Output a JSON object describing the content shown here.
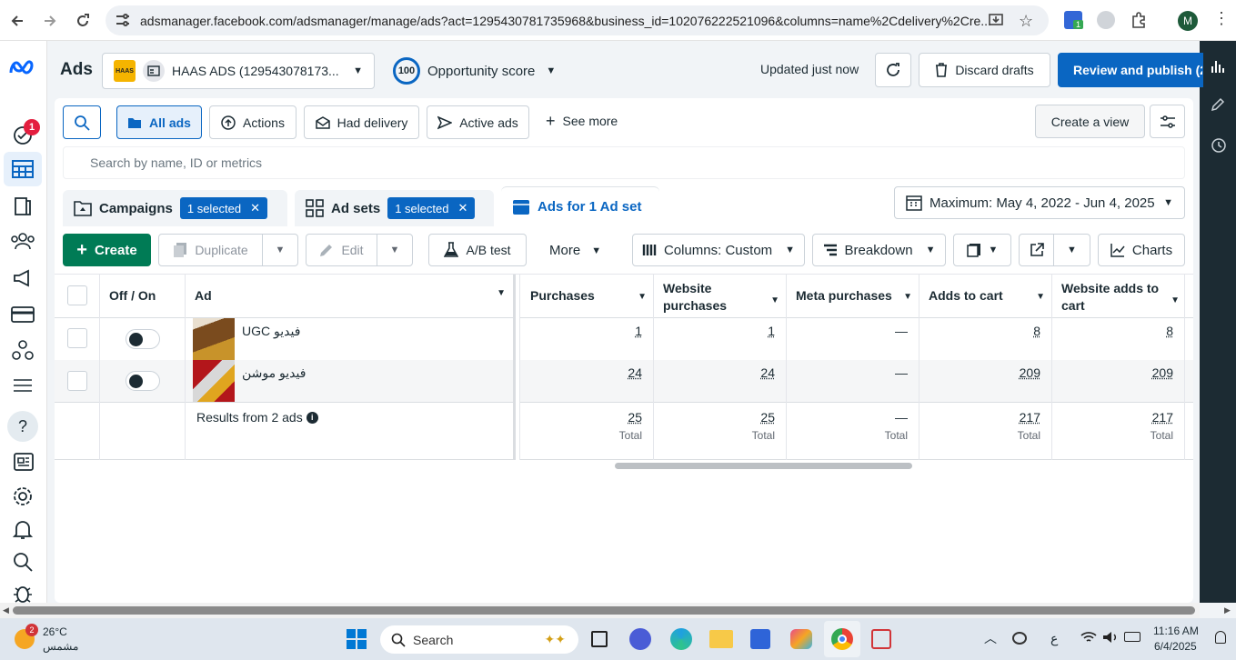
{
  "browser": {
    "url": "adsmanager.facebook.com/adsmanager/manage/ads?act=1295430781735968&business_id=102076222521096&columns=name%2Cdelivery%2Cre...",
    "profile_initial": "M",
    "extension_badge": "1"
  },
  "nav": {
    "notification_count": "1"
  },
  "header": {
    "title": "Ads",
    "account_name": "HAAS ADS (129543078173...",
    "opportunity_score": "100",
    "opportunity_label": "Opportunity score",
    "updated": "Updated just now",
    "discard": "Discard drafts",
    "review": "Review and publish (2"
  },
  "filters": {
    "all_ads": "All ads",
    "actions": "Actions",
    "had_delivery": "Had delivery",
    "active_ads": "Active ads",
    "see_more": "See more",
    "create_view": "Create a view",
    "search_placeholder": "Search by name, ID or metrics"
  },
  "tabs": {
    "campaigns": "Campaigns",
    "campaigns_badge": "1 selected",
    "adsets": "Ad sets",
    "adsets_badge": "1 selected",
    "ads": "Ads for 1 Ad set",
    "date_range": "Maximum: May 4, 2022 - Jun 4, 2025"
  },
  "toolbar": {
    "create": "Create",
    "duplicate": "Duplicate",
    "edit": "Edit",
    "ab_test": "A/B test",
    "more": "More",
    "columns": "Columns: Custom",
    "breakdown": "Breakdown",
    "charts": "Charts"
  },
  "table": {
    "headers": {
      "onoff": "Off / On",
      "ad": "Ad",
      "purchases": "Purchases",
      "website_purchases": "Website purchases",
      "meta_purchases": "Meta purchases",
      "adds_to_cart": "Adds to cart",
      "website_adds": "Website adds to cart"
    },
    "rows": [
      {
        "name": "UGC فيديو",
        "purchases": "1",
        "website_purchases": "1",
        "meta_purchases": "—",
        "adds_to_cart": "8",
        "website_adds": "8"
      },
      {
        "name": "فيديو موشن",
        "purchases": "24",
        "website_purchases": "24",
        "meta_purchases": "—",
        "adds_to_cart": "209",
        "website_adds": "209"
      }
    ],
    "summary": {
      "label": "Results from 2 ads",
      "purchases": "25",
      "website_purchases": "25",
      "meta_purchases": "—",
      "adds_to_cart": "217",
      "website_adds": "217",
      "total_label": "Total"
    }
  },
  "taskbar": {
    "temp": "26°C",
    "weather": "مشمس",
    "weather_badge": "2",
    "search": "Search",
    "time": "11:16 AM",
    "date": "6/4/2025",
    "lang": "ع"
  },
  "colors": {
    "primary": "#0a66c2",
    "create_green": "#007b55",
    "nav_dark": "#1c2b33"
  }
}
